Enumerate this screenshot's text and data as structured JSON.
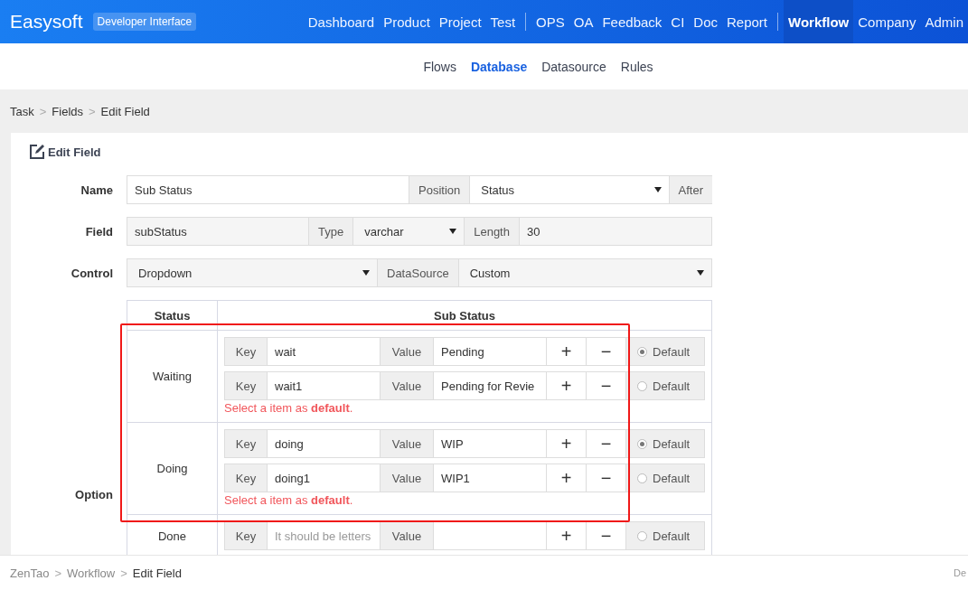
{
  "header": {
    "brand": "Easysoft",
    "badge": "Developer Interface",
    "nav": [
      [
        {
          "label": "Dashboard",
          "selected": false
        },
        {
          "label": "Product",
          "selected": false
        },
        {
          "label": "Project",
          "selected": false
        },
        {
          "label": "Test",
          "selected": false
        }
      ],
      [
        {
          "label": "OPS",
          "selected": false
        },
        {
          "label": "OA",
          "selected": false
        },
        {
          "label": "Feedback",
          "selected": false
        },
        {
          "label": "CI",
          "selected": false
        },
        {
          "label": "Doc",
          "selected": false
        },
        {
          "label": "Report",
          "selected": false
        }
      ],
      [
        {
          "label": "Workflow",
          "selected": true
        },
        {
          "label": "Company",
          "selected": false
        },
        {
          "label": "Admin",
          "selected": false
        }
      ]
    ]
  },
  "subnav": [
    {
      "label": "Flows",
      "selected": false
    },
    {
      "label": "Database",
      "selected": true
    },
    {
      "label": "Datasource",
      "selected": false
    },
    {
      "label": "Rules",
      "selected": false
    }
  ],
  "breadcrumb": [
    "Task",
    ">",
    "Fields",
    ">",
    "Edit Field"
  ],
  "card": {
    "title": "Edit Field",
    "name": {
      "label": "Name",
      "value": "Sub Status",
      "position_label": "Position",
      "position": "Status",
      "after": "After"
    },
    "field": {
      "label": "Field",
      "value": "subStatus",
      "type_label": "Type",
      "type": "varchar",
      "length_label": "Length",
      "length": "30"
    },
    "control": {
      "label": "Control",
      "value": "Dropdown",
      "datasource_label": "DataSource",
      "datasource": "Custom"
    },
    "option": {
      "label": "Option",
      "columns": [
        "Status",
        "Sub Status"
      ],
      "groups": [
        {
          "status": "Waiting",
          "items": [
            {
              "key_label": "Key",
              "key": "wait",
              "value_label": "Value",
              "value": "Pending",
              "add": "+",
              "remove": "−",
              "default_label": "Default",
              "selected": true
            },
            {
              "key_label": "Key",
              "key": "wait1",
              "value_label": "Value",
              "value": "Pending for Revie",
              "add": "+",
              "remove": "−",
              "default_label": "Default",
              "selected": false
            }
          ],
          "error": "Select a item as **default**."
        },
        {
          "status": "Doing",
          "items": [
            {
              "key_label": "Key",
              "key": "doing",
              "value_label": "Value",
              "value": "WIP",
              "add": "+",
              "remove": "−",
              "default_label": "Default",
              "selected": true
            },
            {
              "key_label": "Key",
              "key": "doing1",
              "value_label": "Value",
              "value": "WIP1",
              "add": "+",
              "remove": "−",
              "default_label": "Default",
              "selected": false
            }
          ],
          "error": "Select a item as **default**."
        },
        {
          "status": "Done",
          "items": [
            {
              "key_label": "Key",
              "key_placeholder": "It should be letters",
              "value_label": "Value",
              "add": "+",
              "remove": "−",
              "default_label": "Default",
              "selected": false
            }
          ]
        }
      ]
    }
  },
  "footer": {
    "breadcrumb": [
      "ZenTao",
      ">",
      "Workflow",
      ">",
      "Edit Field"
    ],
    "right": "De"
  }
}
